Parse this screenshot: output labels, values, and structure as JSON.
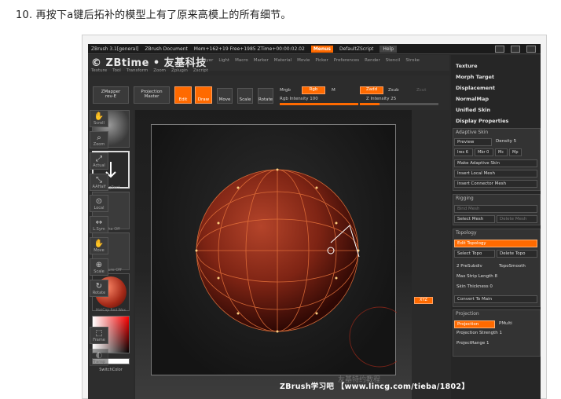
{
  "caption": "10. 再按下a键后拓补的模型上有了原来高模上的所有细节。",
  "title_bar": {
    "app": "ZBrush 3.1[general]",
    "document": "ZBrush Document",
    "memory": "Mem+162+19 Free+1985 ZTime+00:00:02.02",
    "menus": "Menus",
    "script": "DefaultZScript",
    "help": "Help"
  },
  "logo": "© ZBtime • 友基科技",
  "menu_row1": [
    "Layer",
    "Light",
    "Macro",
    "Marker",
    "Material",
    "Movie",
    "Picker",
    "Preferences",
    "Render",
    "Stencil",
    "Stroke"
  ],
  "menu_row2": [
    "Texture",
    "Tool",
    "Transform",
    "Zoom",
    "Zplugin",
    "Zscript"
  ],
  "toolbar": {
    "zmapper": "ZMapper",
    "zmapper_sub": "rev-E",
    "projection": "Projection",
    "projection_sub": "Master",
    "edit": "Edit",
    "draw": "Draw",
    "move": "Move",
    "scale": "Scale",
    "rotate": "Rotate",
    "mrgb": "Mrgb",
    "rgb": "Rgb",
    "m": "M",
    "rgb_intensity": "Rgb Intensity 100",
    "zadd": "Zadd",
    "zsub": "Zsub",
    "zcut": "Zcut",
    "z_intensity": "Z Intensity 25",
    "rgb_intensity_value": 1.0,
    "z_intensity_value": 0.25
  },
  "left_tiles": [
    "",
    "DragRect",
    "Alpha Off",
    "Texture Off",
    "MatCap Red Wax"
  ],
  "switch_color": "SwitchColor",
  "right_buttons": [
    "Scroll",
    "Zoom",
    "Actual",
    "AAHalf",
    "Local",
    "L.Sym",
    "Move",
    "Scale",
    "Rotate",
    "XYZ",
    "Frame",
    "Transp"
  ],
  "panel_links": [
    "Texture",
    "Morph Target",
    "Displacement",
    "NormalMap",
    "Unified Skin",
    "Display Properties"
  ],
  "adaptive_skin": {
    "title": "Adaptive Skin",
    "preview": "Preview",
    "density": "Density 5",
    "ires": "Ires 6",
    "mbr": "Mbr 0",
    "mc": "Mc",
    "mp": "Mp",
    "make": "Make Adaptive Skin",
    "insert_local": "Insert Local Mesh",
    "insert_connector": "Insert Connector Mesh"
  },
  "rigging": {
    "title": "Rigging",
    "bind": "Bind Mesh",
    "select": "Select Mesh",
    "delete": "Delete Mesh"
  },
  "topology": {
    "title": "Topology",
    "edit": "Edit Topology",
    "select_topo": "Select Topo",
    "delete_topo": "Delete Topo",
    "presubdiv": "2 PreSubdiv",
    "toposmooth": "TopoSmooth",
    "max_strip": "Max Strip Length 8",
    "skin_thickness": "Skin Thickness 0",
    "convert": "Convert To Main"
  },
  "projection": {
    "title": "Projection",
    "btn": "Projection",
    "pmulti": "PMulti",
    "strength": "Projection Strength 1",
    "range": "ProjectRange 1"
  },
  "watermark": "ZBrush学习吧 【www.lincg.com/tieba/1802】",
  "watermark_bg": "友基特约教程",
  "accent_color": "#ff6a00"
}
